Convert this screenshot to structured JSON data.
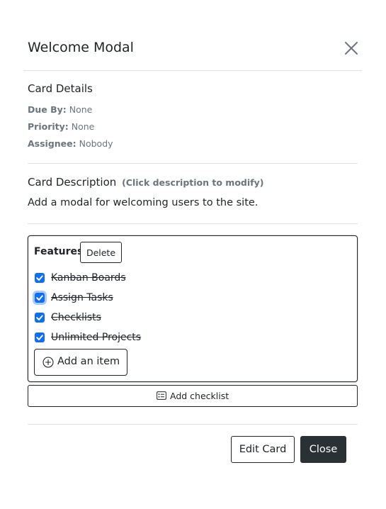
{
  "modal": {
    "title": "Welcome Modal"
  },
  "details": {
    "heading": "Card Details",
    "due_label": "Due By:",
    "due_value": "None",
    "priority_label": "Priority:",
    "priority_value": "None",
    "assignee_label": "Assignee:",
    "assignee_value": "Nobody"
  },
  "description": {
    "heading": "Card Description",
    "hint": "(Click description to modify)",
    "text": "Add a modal for welcoming users to the site."
  },
  "checklist": {
    "title": "Features",
    "delete_label": "Delete",
    "items": [
      {
        "label": "Kanban Boards",
        "checked": true
      },
      {
        "label": "Assign Tasks",
        "checked": true
      },
      {
        "label": "Checklists",
        "checked": true
      },
      {
        "label": "Unlimited Projects",
        "checked": true
      }
    ],
    "add_item_label": "Add an item"
  },
  "add_checklist_label": "Add checklist",
  "footer": {
    "edit_label": "Edit Card",
    "close_label": "Close"
  },
  "colors": {
    "checkbox": "#0d6efd",
    "close_button_bg": "#293135",
    "muted_text": "#6c757d"
  }
}
